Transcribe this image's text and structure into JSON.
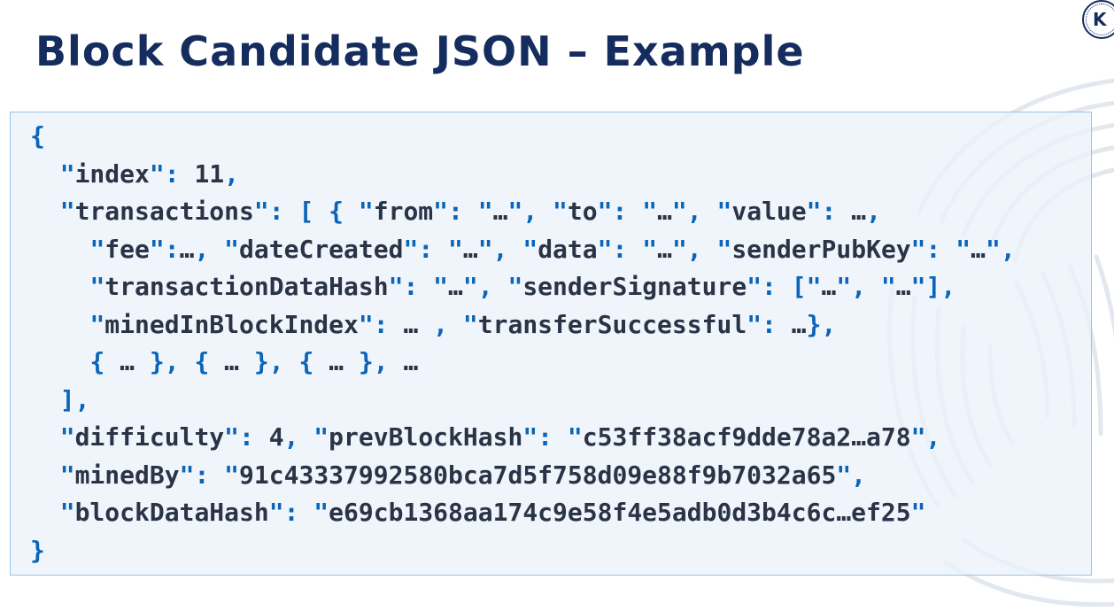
{
  "title": "Block Candidate JSON – Example",
  "logo": {
    "letter": "K"
  },
  "code_lines": [
    {
      "indent": "",
      "segments": [
        {
          "t": "{",
          "c": "p"
        }
      ]
    },
    {
      "indent": "  ",
      "segments": [
        {
          "t": "\"",
          "c": "p"
        },
        {
          "t": "index",
          "c": "k"
        },
        {
          "t": "\": ",
          "c": "p"
        },
        {
          "t": "11",
          "c": "v"
        },
        {
          "t": ",",
          "c": "p"
        }
      ]
    },
    {
      "indent": "  ",
      "segments": [
        {
          "t": "\"",
          "c": "p"
        },
        {
          "t": "transactions",
          "c": "k"
        },
        {
          "t": "\": [ { \"",
          "c": "p"
        },
        {
          "t": "from",
          "c": "k"
        },
        {
          "t": "\": \"",
          "c": "p"
        },
        {
          "t": "…",
          "c": "v"
        },
        {
          "t": "\", \"",
          "c": "p"
        },
        {
          "t": "to",
          "c": "k"
        },
        {
          "t": "\": \"",
          "c": "p"
        },
        {
          "t": "…",
          "c": "v"
        },
        {
          "t": "\", \"",
          "c": "p"
        },
        {
          "t": "value",
          "c": "k"
        },
        {
          "t": "\": ",
          "c": "p"
        },
        {
          "t": "…",
          "c": "v"
        },
        {
          "t": ",",
          "c": "p"
        }
      ]
    },
    {
      "indent": "    ",
      "segments": [
        {
          "t": "\"",
          "c": "p"
        },
        {
          "t": "fee",
          "c": "k"
        },
        {
          "t": "\":",
          "c": "p"
        },
        {
          "t": "…",
          "c": "v"
        },
        {
          "t": ", \"",
          "c": "p"
        },
        {
          "t": "dateCreated",
          "c": "k"
        },
        {
          "t": "\": \"",
          "c": "p"
        },
        {
          "t": "…",
          "c": "v"
        },
        {
          "t": "\", \"",
          "c": "p"
        },
        {
          "t": "data",
          "c": "k"
        },
        {
          "t": "\": \"",
          "c": "p"
        },
        {
          "t": "…",
          "c": "v"
        },
        {
          "t": "\", \"",
          "c": "p"
        },
        {
          "t": "senderPubKey",
          "c": "k"
        },
        {
          "t": "\": \"",
          "c": "p"
        },
        {
          "t": "…",
          "c": "v"
        },
        {
          "t": "\",",
          "c": "p"
        }
      ]
    },
    {
      "indent": "    ",
      "segments": [
        {
          "t": "\"",
          "c": "p"
        },
        {
          "t": "transactionDataHash",
          "c": "k"
        },
        {
          "t": "\": \"",
          "c": "p"
        },
        {
          "t": "…",
          "c": "v"
        },
        {
          "t": "\", \"",
          "c": "p"
        },
        {
          "t": "senderSignature",
          "c": "k"
        },
        {
          "t": "\": [\"",
          "c": "p"
        },
        {
          "t": "…",
          "c": "v"
        },
        {
          "t": "\", \"",
          "c": "p"
        },
        {
          "t": "…",
          "c": "v"
        },
        {
          "t": "\"],",
          "c": "p"
        }
      ]
    },
    {
      "indent": "    ",
      "segments": [
        {
          "t": "\"",
          "c": "p"
        },
        {
          "t": "minedInBlockIndex",
          "c": "k"
        },
        {
          "t": "\": ",
          "c": "p"
        },
        {
          "t": "…",
          "c": "v"
        },
        {
          "t": " , \"",
          "c": "p"
        },
        {
          "t": "transferSuccessful",
          "c": "k"
        },
        {
          "t": "\": ",
          "c": "p"
        },
        {
          "t": "…",
          "c": "v"
        },
        {
          "t": "},",
          "c": "p"
        }
      ]
    },
    {
      "indent": "    ",
      "segments": [
        {
          "t": "{ ",
          "c": "p"
        },
        {
          "t": "…",
          "c": "v"
        },
        {
          "t": " }, { ",
          "c": "p"
        },
        {
          "t": "…",
          "c": "v"
        },
        {
          "t": " }, { ",
          "c": "p"
        },
        {
          "t": "…",
          "c": "v"
        },
        {
          "t": " }, ",
          "c": "p"
        },
        {
          "t": "…",
          "c": "v"
        }
      ]
    },
    {
      "indent": "  ",
      "segments": [
        {
          "t": "],",
          "c": "p"
        }
      ]
    },
    {
      "indent": "  ",
      "segments": [
        {
          "t": "\"",
          "c": "p"
        },
        {
          "t": "difficulty",
          "c": "k"
        },
        {
          "t": "\": ",
          "c": "p"
        },
        {
          "t": "4",
          "c": "v"
        },
        {
          "t": ", \"",
          "c": "p"
        },
        {
          "t": "prevBlockHash",
          "c": "k"
        },
        {
          "t": "\": \"",
          "c": "p"
        },
        {
          "t": "c53ff38acf9dde78a2…a78",
          "c": "v"
        },
        {
          "t": "\",",
          "c": "p"
        }
      ]
    },
    {
      "indent": "  ",
      "segments": [
        {
          "t": "\"",
          "c": "p"
        },
        {
          "t": "minedBy",
          "c": "k"
        },
        {
          "t": "\": \"",
          "c": "p"
        },
        {
          "t": "91c43337992580bca7d5f758d09e88f9b7032a65",
          "c": "v"
        },
        {
          "t": "\",",
          "c": "p"
        }
      ]
    },
    {
      "indent": "  ",
      "segments": [
        {
          "t": "\"",
          "c": "p"
        },
        {
          "t": "blockDataHash",
          "c": "k"
        },
        {
          "t": "\": \"",
          "c": "p"
        },
        {
          "t": "e69cb1368aa174c9e58f4e5adb0d3b4c6c…ef25",
          "c": "v"
        },
        {
          "t": "\"",
          "c": "p"
        }
      ]
    },
    {
      "indent": "",
      "segments": [
        {
          "t": "}",
          "c": "p"
        }
      ]
    }
  ]
}
